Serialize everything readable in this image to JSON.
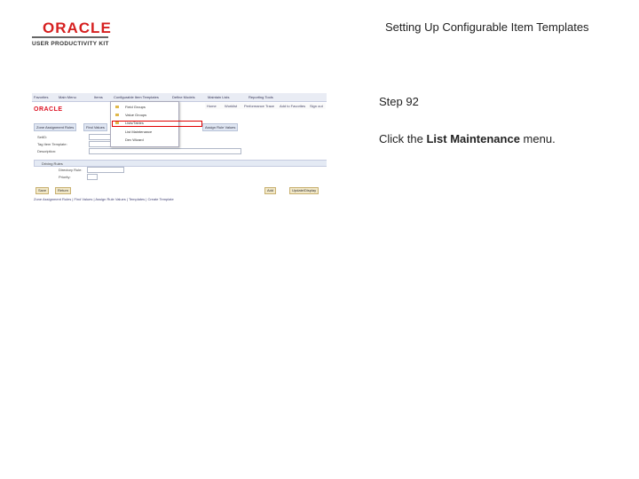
{
  "header": {
    "logo_text": "ORACLE",
    "logo_subtitle": "USER PRODUCTIVITY KIT",
    "document_title": "Setting Up Configurable Item Templates"
  },
  "step": {
    "label": "Step 92",
    "instruction_prefix": "Click the ",
    "instruction_target": "List Maintenance",
    "instruction_suffix": " menu."
  },
  "screenshot": {
    "menubar_items": [
      "Favorites",
      "Main Menu",
      "Items",
      "Configurable Item Templates",
      "Define Models",
      "Maintain Lists",
      "Reporting Tools"
    ],
    "brand": "ORACLE",
    "nav_links": [
      "Home",
      "Worklist",
      "Performance Trace",
      "Add to Favorites",
      "Sign out"
    ],
    "tabs": [
      "Zone Assignment Rules",
      "Find Values",
      "Assign Rule Values"
    ],
    "dropdown_items": [
      "Field Groups",
      "Value Groups",
      "Lists/Tables",
      "List Maintenance",
      "Dev Wizard"
    ],
    "form_rows": [
      "SetID:",
      "Tag Item Template:",
      "Description:"
    ],
    "grid_title": "Driving Rules",
    "grid_fields": [
      "Directory Rule:",
      "Priority:"
    ],
    "buttons_left": [
      "Save",
      "Return"
    ],
    "buttons_right": [
      "Add",
      "Update/Display"
    ],
    "footer": "Zone Assignment Rules | Find Values | Assign Rule Values | Templates | Create Template"
  }
}
